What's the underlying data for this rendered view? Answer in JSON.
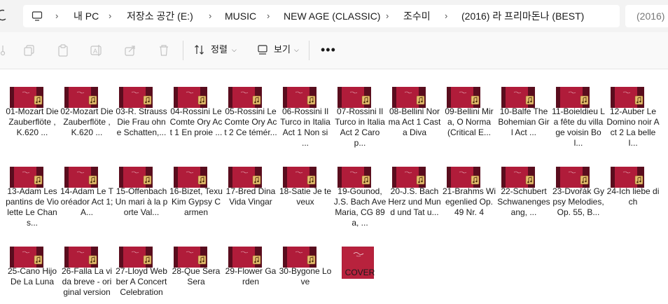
{
  "breadcrumb": {
    "items": [
      "내 PC",
      "저장소 공간 (E:)",
      "MUSIC",
      "NEW AGE (CLASSIC)",
      "조수미",
      "(2016) 라 프리마돈나 (BEST)"
    ]
  },
  "search": {
    "placeholder": "(2016)"
  },
  "toolbar": {
    "sort_label": "정렬",
    "view_label": "보기"
  },
  "colors": {
    "thumb_dark": "#5a0d1e",
    "thumb_main": "#b01c3a",
    "thumb_badge": "#e8c070",
    "cover": "#b8223d"
  },
  "files": [
    {
      "type": "audio",
      "label": "01-Mozart Die Zauberflöte , K.620 ..."
    },
    {
      "type": "audio",
      "label": "02-Mozart Die Zauberflöte , K.620 ..."
    },
    {
      "type": "audio",
      "label": "03-R. Strauss Die Frau ohne Schatten,..."
    },
    {
      "type": "audio",
      "label": "04-Rossini Le Comte Ory  Act 1 En proie ..."
    },
    {
      "type": "audio",
      "label": "05-Rossini Le Comte Ory  Act 2 Ce témér..."
    },
    {
      "type": "audio",
      "label": "06-Rossini Il Turco in Italia  Act 1 Non si ..."
    },
    {
      "type": "audio",
      "label": "07-Rossini Il Turco in Italia  Act 2 Caro p..."
    },
    {
      "type": "audio",
      "label": "08-Bellini Norma Act 1 Casta Diva"
    },
    {
      "type": "audio",
      "label": "09-Bellini Mira, O Norma (Critical E..."
    },
    {
      "type": "audio",
      "label": "10-Balfe The Bohemian Girl  Act ..."
    },
    {
      "type": "audio",
      "label": "11-Boieldieu La fête du village voisin Bol..."
    },
    {
      "type": "audio",
      "label": "12-Auber Le Domino noir  Act 2 La belle I..."
    },
    {
      "type": "audio",
      "label": "13-Adam Les pantins de Violette Le Chans..."
    },
    {
      "type": "audio",
      "label": "14-Adam Le Toréador Act 1; A..."
    },
    {
      "type": "audio",
      "label": "15-Offenbach Un mari à la porte Val..."
    },
    {
      "type": "audio",
      "label": "16-Bizet, Texu Kim Gypsy Carmen"
    },
    {
      "type": "audio",
      "label": "17-Bred Dina Vida Vingar"
    },
    {
      "type": "audio",
      "label": "18-Satie Je te veux"
    },
    {
      "type": "audio",
      "label": "19-Gounod, J.S. Bach Ave Maria, CG 89a, ..."
    },
    {
      "type": "audio",
      "label": "20-J.S. Bach Herz und Mund und Tat u..."
    },
    {
      "type": "audio",
      "label": "21-Brahms Wiegenlied Op. 49 Nr. 4"
    },
    {
      "type": "audio",
      "label": "22-Schubert Schwanengesang, ..."
    },
    {
      "type": "audio",
      "label": "23-Dvořák Gypsy Melodies, Op. 55, B..."
    },
    {
      "type": "audio",
      "label": "24-Ich liebe dich"
    },
    {
      "type": "audio",
      "label": "25-Cano Hijo De La Luna"
    },
    {
      "type": "audio",
      "label": "26-Falla La vida breve - original version"
    },
    {
      "type": "audio",
      "label": "27-Lloyd Webber A Concert Celebration"
    },
    {
      "type": "audio",
      "label": "28-Que Sera Sera"
    },
    {
      "type": "audio",
      "label": "29-Flower Garden"
    },
    {
      "type": "audio",
      "label": "30-Bygone Love"
    },
    {
      "type": "image",
      "label": "COVER"
    }
  ]
}
